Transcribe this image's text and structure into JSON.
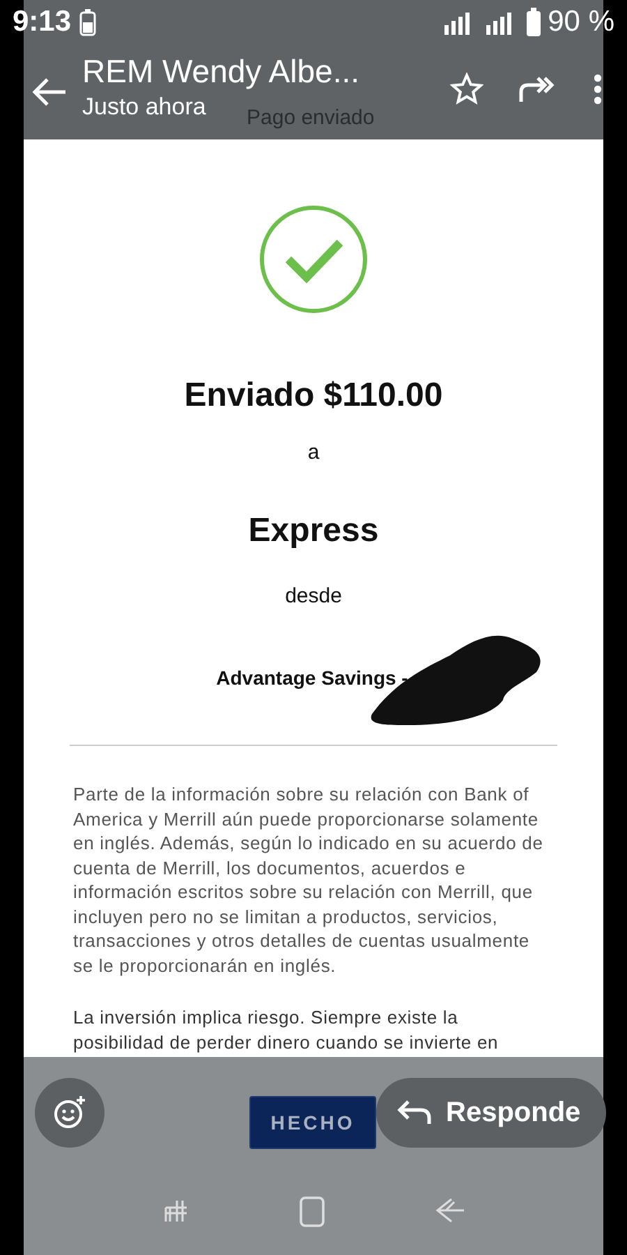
{
  "status_bar": {
    "time": "9:13",
    "battery": "90 %"
  },
  "header": {
    "title": "REM Wendy Albe...",
    "subtitle": "Justo ahora",
    "underlying_title": "Pago enviado"
  },
  "receipt": {
    "amount": "Enviado $110.00",
    "to_label": "a",
    "recipient": "Express",
    "from_label": "desde",
    "account": "Advantage Savings -",
    "paragraphs": [
      "Parte de la información sobre su relación con Bank of America y Merrill aún puede proporcionarse solamente en inglés. Además, según lo indicado en su acuerdo de cuenta de Merrill, los documentos, acuerdos e información escritos sobre su relación con Merrill, que incluyen pero no se limitan a productos, servicios, transacciones y otros detalles de cuentas usualmente se le proporcionarán en inglés.",
      "La inversión implica riesgo. Siempre existe la posibilidad de perder dinero cuando se invierte en"
    ]
  },
  "actions": {
    "done": "HECHO",
    "reply": "Responde"
  }
}
